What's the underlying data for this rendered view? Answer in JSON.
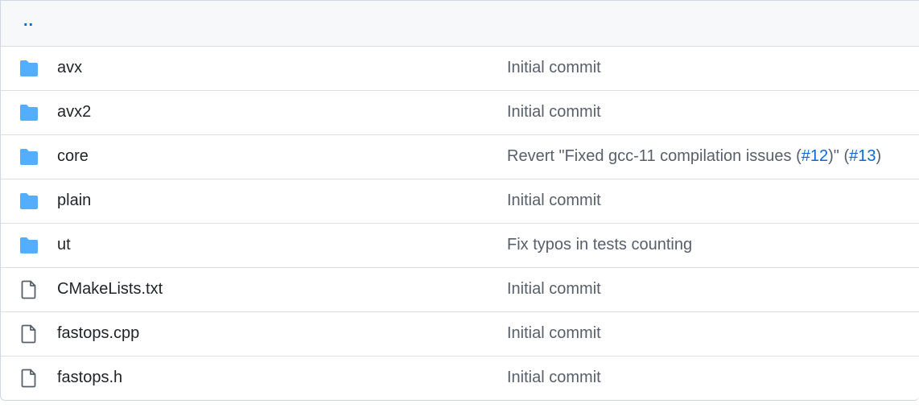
{
  "parent_link": "..",
  "rows": [
    {
      "type": "folder",
      "icon": "folder-icon",
      "name": "avx",
      "commit": "Initial commit"
    },
    {
      "type": "folder",
      "icon": "folder-icon",
      "name": "avx2",
      "commit": "Initial commit"
    },
    {
      "type": "folder",
      "icon": "folder-icon",
      "name": "core",
      "commit_parts": {
        "prefix": "Revert \"Fixed gcc-11 compilation issues (",
        "link1": "#12",
        "middle": ")\" (",
        "link2": "#13",
        "suffix": ")"
      }
    },
    {
      "type": "folder",
      "icon": "folder-icon",
      "name": "plain",
      "commit": "Initial commit"
    },
    {
      "type": "folder",
      "icon": "folder-icon",
      "name": "ut",
      "commit": "Fix typos in tests counting"
    },
    {
      "type": "file",
      "icon": "file-icon",
      "name": "CMakeLists.txt",
      "commit": "Initial commit"
    },
    {
      "type": "file",
      "icon": "file-icon",
      "name": "fastops.cpp",
      "commit": "Initial commit"
    },
    {
      "type": "file",
      "icon": "file-icon",
      "name": "fastops.h",
      "commit": "Initial commit"
    }
  ],
  "colors": {
    "folder": "#54aeff",
    "file": "#57606a",
    "link": "#0969da",
    "muted": "#57606a",
    "border": "#d0d7de",
    "header_bg": "#f6f8fa"
  }
}
